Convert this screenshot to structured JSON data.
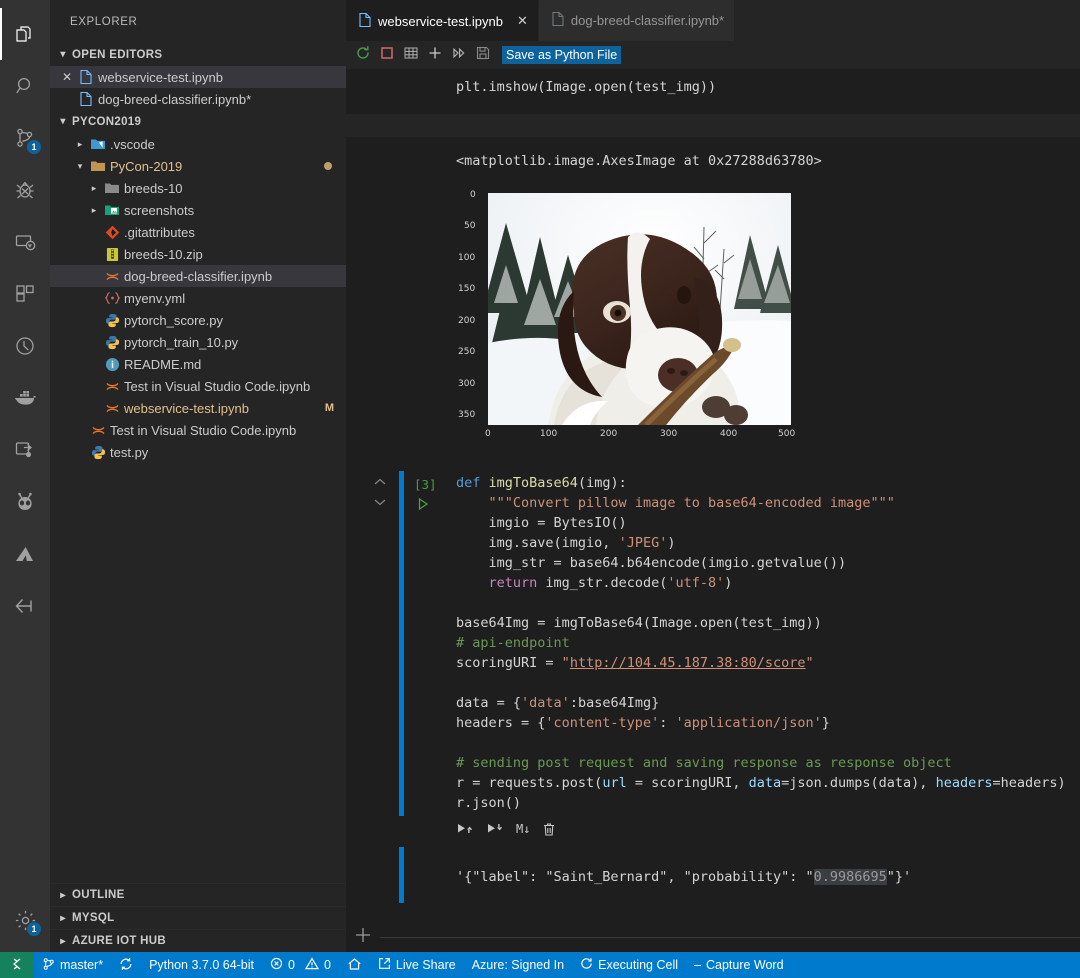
{
  "activity_bar": {
    "items": [
      {
        "name": "explorer",
        "icon": "files-icon",
        "active": true,
        "badge": null
      },
      {
        "name": "search",
        "icon": "search-icon",
        "active": false,
        "badge": null
      },
      {
        "name": "source-control",
        "icon": "source-control-icon",
        "active": false,
        "badge": "1"
      },
      {
        "name": "debug",
        "icon": "debug-icon",
        "active": false,
        "badge": null
      },
      {
        "name": "remote-explorer",
        "icon": "remote-monitor-icon",
        "active": false,
        "badge": null
      },
      {
        "name": "extensions",
        "icon": "extensions-icon",
        "active": false,
        "badge": null
      },
      {
        "name": "test",
        "icon": "beaker-circle-icon",
        "active": false,
        "badge": null
      },
      {
        "name": "docker",
        "icon": "docker-whale-icon",
        "active": false,
        "badge": null
      },
      {
        "name": "live-share",
        "icon": "live-share-icon",
        "active": false,
        "badge": null
      },
      {
        "name": "platformio",
        "icon": "alien-ant-icon",
        "active": false,
        "badge": null
      },
      {
        "name": "azure",
        "icon": "azure-icon",
        "active": false,
        "badge": null
      },
      {
        "name": "arduino",
        "icon": "arrow-diamond-icon",
        "active": false,
        "badge": null
      }
    ],
    "bottom_items": [
      {
        "name": "manage-settings",
        "icon": "gear-icon",
        "badge": "1"
      }
    ]
  },
  "sidebar": {
    "title": "EXPLORER",
    "open_editors": {
      "header": "OPEN EDITORS",
      "expanded": true,
      "items": [
        {
          "label": "webservice-test.ipynb",
          "icon": "notebook-file-icon",
          "close": true,
          "selected": true,
          "dirty": false
        },
        {
          "label": "dog-breed-classifier.ipynb*",
          "icon": "notebook-file-icon",
          "close": false,
          "selected": false,
          "dirty": true
        }
      ]
    },
    "project": {
      "header": "PYCON2019",
      "expanded": true,
      "items": [
        {
          "label": ".vscode",
          "icon": "folder-vscode-icon",
          "twisty": "collapsed",
          "indent": 1,
          "kind": "folder"
        },
        {
          "label": "PyCon-2019",
          "icon": "folder-open-icon",
          "twisty": "expanded",
          "indent": 1,
          "kind": "folder",
          "gold": true,
          "dot": true
        },
        {
          "label": "breeds-10",
          "icon": "folder-icon",
          "twisty": "collapsed",
          "indent": 2,
          "kind": "folder"
        },
        {
          "label": "screenshots",
          "icon": "folder-images-icon",
          "twisty": "collapsed",
          "indent": 2,
          "kind": "folder"
        },
        {
          "label": ".gitattributes",
          "icon": "git-icon",
          "twisty": "none",
          "indent": 2,
          "kind": "file"
        },
        {
          "label": "breeds-10.zip",
          "icon": "zip-icon",
          "twisty": "none",
          "indent": 2,
          "kind": "file"
        },
        {
          "label": "dog-breed-classifier.ipynb",
          "icon": "jupyter-icon",
          "twisty": "none",
          "indent": 2,
          "kind": "file",
          "selected": true
        },
        {
          "label": "myenv.yml",
          "icon": "yaml-icon",
          "twisty": "none",
          "indent": 2,
          "kind": "file"
        },
        {
          "label": "pytorch_score.py",
          "icon": "python-icon",
          "twisty": "none",
          "indent": 2,
          "kind": "file"
        },
        {
          "label": "pytorch_train_10.py",
          "icon": "python-icon",
          "twisty": "none",
          "indent": 2,
          "kind": "file"
        },
        {
          "label": "README.md",
          "icon": "info-icon",
          "twisty": "none",
          "indent": 2,
          "kind": "file"
        },
        {
          "label": "Test in Visual Studio Code.ipynb",
          "icon": "jupyter-icon",
          "twisty": "none",
          "indent": 2,
          "kind": "file"
        },
        {
          "label": "webservice-test.ipynb",
          "icon": "jupyter-icon",
          "twisty": "none",
          "indent": 2,
          "kind": "file",
          "suffix": "M"
        },
        {
          "label": "Test in Visual Studio Code.ipynb",
          "icon": "jupyter-icon",
          "twisty": "none",
          "indent": 1,
          "kind": "file"
        },
        {
          "label": "test.py",
          "icon": "python-icon",
          "twisty": "none",
          "indent": 1,
          "kind": "file"
        }
      ]
    },
    "bottom_sections": [
      {
        "header": "OUTLINE",
        "expanded": false
      },
      {
        "header": "MYSQL",
        "expanded": false
      },
      {
        "header": "AZURE IOT HUB",
        "expanded": false
      }
    ]
  },
  "editor": {
    "tabs": [
      {
        "label": "webservice-test.ipynb",
        "active": true,
        "dirty": false,
        "closable": true
      },
      {
        "label": "dog-breed-classifier.ipynb*",
        "active": false,
        "dirty": true,
        "closable": false
      }
    ],
    "toolbar": {
      "buttons": [
        {
          "name": "restart-kernel-button",
          "icon": "restart-icon"
        },
        {
          "name": "interrupt-kernel-button",
          "icon": "stop-square-icon"
        },
        {
          "name": "variables-button",
          "icon": "grid-table-icon"
        },
        {
          "name": "add-cell-button",
          "icon": "plus-icon"
        },
        {
          "name": "run-all-cells-button",
          "icon": "run-all-icon"
        },
        {
          "name": "save-as-python-file-button",
          "icon": "save-disk-icon"
        }
      ],
      "tooltip": "Save as Python File"
    }
  },
  "notebook": {
    "top_cell": {
      "code_line": "plt.imshow(Image.open(test_img))",
      "repr_output": "<matplotlib.image.AxesImage at 0x27288d63780>"
    },
    "figure": {
      "alt": "matplotlib imshow of a springer spaniel dog holding a stick in snow"
    },
    "cell": {
      "execution_count": "[3]",
      "run_icon": "play-triangle-icon",
      "code_lines": [
        [
          {
            "t": "kw",
            "s": "def"
          },
          {
            "t": "plain",
            "s": " "
          },
          {
            "t": "fn",
            "s": "imgToBase64"
          },
          {
            "t": "plain",
            "s": "(img):"
          }
        ],
        [
          {
            "t": "plain",
            "s": "    "
          },
          {
            "t": "str",
            "s": "\"\"\"Convert pillow image to base64-encoded image\"\"\""
          }
        ],
        [
          {
            "t": "plain",
            "s": "    imgio = BytesIO()"
          }
        ],
        [
          {
            "t": "plain",
            "s": "    img.save(imgio, "
          },
          {
            "t": "str",
            "s": "'JPEG'"
          },
          {
            "t": "plain",
            "s": ")"
          }
        ],
        [
          {
            "t": "plain",
            "s": "    img_str = base64.b64encode(imgio.getvalue())"
          }
        ],
        [
          {
            "t": "plain",
            "s": "    "
          },
          {
            "t": "kw2",
            "s": "return"
          },
          {
            "t": "plain",
            "s": " img_str.decode("
          },
          {
            "t": "str",
            "s": "'utf-8'"
          },
          {
            "t": "plain",
            "s": ")"
          }
        ],
        [
          {
            "t": "plain",
            "s": ""
          }
        ],
        [
          {
            "t": "plain",
            "s": "base64Img = imgToBase64(Image.open(test_img))"
          }
        ],
        [
          {
            "t": "com",
            "s": "# api-endpoint"
          }
        ],
        [
          {
            "t": "plain",
            "s": "scoringURI = "
          },
          {
            "t": "str",
            "s": "\""
          },
          {
            "t": "link",
            "s": "http://104.45.187.38:80/score"
          },
          {
            "t": "str",
            "s": "\""
          }
        ],
        [
          {
            "t": "plain",
            "s": ""
          }
        ],
        [
          {
            "t": "plain",
            "s": "data = {"
          },
          {
            "t": "str",
            "s": "'data'"
          },
          {
            "t": "plain",
            "s": ":base64Img}"
          }
        ],
        [
          {
            "t": "plain",
            "s": "headers = {"
          },
          {
            "t": "str",
            "s": "'content-type'"
          },
          {
            "t": "plain",
            "s": ": "
          },
          {
            "t": "str",
            "s": "'application/json'"
          },
          {
            "t": "plain",
            "s": "}"
          }
        ],
        [
          {
            "t": "plain",
            "s": ""
          }
        ],
        [
          {
            "t": "com",
            "s": "# sending post request and saving response as response object"
          }
        ],
        [
          {
            "t": "plain",
            "s": "r = requests.post("
          },
          {
            "t": "var",
            "s": "url"
          },
          {
            "t": "plain",
            "s": " = scoringURI, "
          },
          {
            "t": "var",
            "s": "data"
          },
          {
            "t": "plain",
            "s": "=json.dumps(data), "
          },
          {
            "t": "var",
            "s": "headers"
          },
          {
            "t": "plain",
            "s": "=headers)"
          }
        ],
        [
          {
            "t": "plain",
            "s": "r.json()"
          }
        ]
      ],
      "actions": [
        {
          "name": "run-above-button",
          "icon": "run-above-icon"
        },
        {
          "name": "run-below-button",
          "icon": "run-below-icon"
        },
        {
          "name": "change-to-markdown-button",
          "icon": "markdown-icon",
          "label": "M↓"
        },
        {
          "name": "delete-cell-button",
          "icon": "trash-icon"
        }
      ],
      "output_prefix": "'{\"label\": \"Saint_Bernard\", \"probability\": \"",
      "output_selected": "0.9986695",
      "output_suffix": "\"}'"
    },
    "add_cell_label": "+"
  },
  "chart_data": {
    "type": "heatmap",
    "title": "",
    "xlabel": "",
    "ylabel": "",
    "xlim": [
      0,
      500
    ],
    "ylim": [
      375,
      0
    ],
    "xticks": [
      0,
      100,
      200,
      300,
      400,
      500
    ],
    "yticks": [
      0,
      50,
      100,
      150,
      200,
      250,
      300,
      350
    ],
    "grid": false,
    "legend": "none",
    "annotation": "matplotlib.image.AxesImage — photograph of a springer spaniel dog in snow"
  },
  "status_bar": {
    "remote_icon": "remote-connection-icon",
    "items": [
      {
        "name": "branch",
        "icon": "git-branch-icon",
        "label": "master*"
      },
      {
        "name": "sync",
        "icon": "sync-icon",
        "label": ""
      },
      {
        "name": "python-interpreter",
        "icon": null,
        "label": "Python 3.7.0 64-bit"
      },
      {
        "name": "problems-errors",
        "icon": "error-circle-icon",
        "label": "0"
      },
      {
        "name": "problems-warnings",
        "icon": "warning-triangle-icon",
        "label": "0"
      },
      {
        "name": "home",
        "icon": "home-icon",
        "label": ""
      },
      {
        "name": "live-share",
        "icon": "live-share-status-icon",
        "label": "Live Share"
      },
      {
        "name": "azure-account",
        "icon": null,
        "label": "Azure: Signed In"
      },
      {
        "name": "executing-cell",
        "icon": "spinner-icon",
        "label": "Executing Cell"
      },
      {
        "name": "capture-word",
        "icon": "dash-icon",
        "label": "Capture Word"
      }
    ]
  },
  "colors": {
    "accent": "#007acc",
    "remote_green": "#16825d",
    "sidebar_bg": "#252526",
    "editor_bg": "#1e1e1e",
    "activity_bg": "#333333",
    "selection_bg": "#37373d",
    "badge_bg": "#0e639c",
    "comment": "#6a9955",
    "string": "#ce9178",
    "keyword": "#569cd6",
    "function": "#dcdcaa",
    "variable": "#9cdcfe",
    "exec_count": "#4a9c4a"
  }
}
